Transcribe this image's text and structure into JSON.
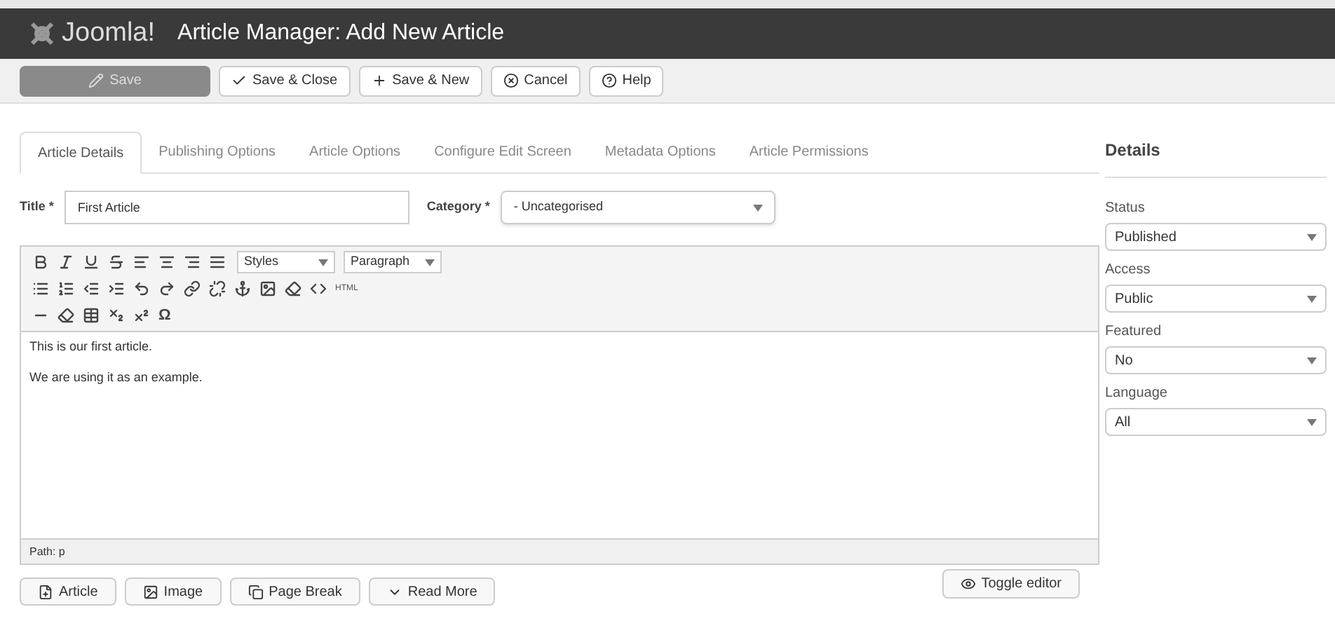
{
  "header": {
    "brand": "Joomla!",
    "title": "Article Manager: Add New Article"
  },
  "toolbar": [
    {
      "label": "Save",
      "kind": "primary"
    },
    {
      "label": "Save & Close",
      "kind": "default"
    },
    {
      "label": "Save & New",
      "kind": "default"
    },
    {
      "label": "Cancel",
      "kind": "default"
    },
    {
      "label": "Help",
      "kind": "default"
    }
  ],
  "tabs": [
    {
      "label": "Article Details",
      "selected": true
    },
    {
      "label": "Publishing Options",
      "selected": false
    },
    {
      "label": "Article Options",
      "selected": false
    },
    {
      "label": "Configure Edit Screen",
      "selected": false
    },
    {
      "label": "Metadata Options",
      "selected": false
    },
    {
      "label": "Article Permissions",
      "selected": false
    }
  ],
  "title_field": {
    "label": "Title",
    "required_mark": "*",
    "value": "First Article"
  },
  "category_field": {
    "label": "Category",
    "required_mark": "*",
    "value": "- Uncategorised"
  },
  "editor": {
    "styles_select": "Styles",
    "format_select": "Paragraph",
    "html_button": "HTML",
    "special_char": "Ω",
    "paragraphs": [
      "This is our first article.",
      "We are using it as an example."
    ],
    "path": "Path: p"
  },
  "editor_buttons": [
    {
      "label": "Article"
    },
    {
      "label": "Image"
    },
    {
      "label": "Page Break"
    },
    {
      "label": "Read More"
    }
  ],
  "toggle_editor": "Toggle editor",
  "sidebar": {
    "heading": "Details",
    "fields": [
      {
        "label": "Status",
        "value": "Published"
      },
      {
        "label": "Access",
        "value": "Public"
      },
      {
        "label": "Featured",
        "value": "No"
      },
      {
        "label": "Language",
        "value": "All"
      }
    ]
  }
}
